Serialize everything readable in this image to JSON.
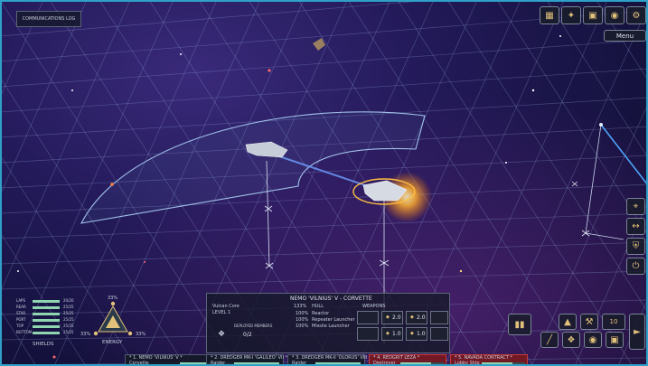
{
  "topleft": {
    "comms_label": "COMMUNICATIONS LOG"
  },
  "topright": {
    "menu_label": "Menu",
    "icons": [
      "map-icon",
      "ship-icon",
      "screen-icon",
      "target-icon",
      "gear-icon"
    ]
  },
  "rightside": {
    "icons": [
      "crosshair-icon",
      "expand-icon",
      "shield-icon",
      "power-icon"
    ]
  },
  "left_stats": {
    "energy_pct": "33%",
    "left_pct": "33%",
    "right_pct": "33%",
    "shields_label": "SHIELDS",
    "energy_label": "ENERGY",
    "rows": [
      {
        "name": "LAPS",
        "value": "20/20",
        "fill": 1.0
      },
      {
        "name": "REAR",
        "value": "25/25",
        "fill": 1.0
      },
      {
        "name": "STAR",
        "value": "25/25",
        "fill": 1.0
      },
      {
        "name": "PORT",
        "value": "25/25",
        "fill": 1.0
      },
      {
        "name": "TOP",
        "value": "25/25",
        "fill": 1.0
      },
      {
        "name": "BOTTOM",
        "value": "25/25",
        "fill": 1.0
      }
    ]
  },
  "ship_panel": {
    "title": "NEMO 'VILNIUS' V - CORVETTE",
    "subtitle_left": "Vulcan Core",
    "level": "LEVEL 1",
    "hull_pct": "133%",
    "hull_label": "HULL",
    "weapons_label": "WEAPONS",
    "systems": [
      {
        "pct": "100%",
        "name": "Reactor"
      },
      {
        "pct": "100%",
        "name": "Repeater Launcher"
      },
      {
        "pct": "100%",
        "name": "Missile Launcher"
      }
    ],
    "crew_label": "DEPLOYED MEMBERS",
    "crew_value": "0/2",
    "weapon_slots": [
      "2.0",
      "2.0",
      "1.0",
      "1.0"
    ]
  },
  "action_panel": {
    "counter": "10"
  },
  "fleet_tabs": [
    {
      "title": "* 1. NEMO 'VILNIUS' V *",
      "sub": "Corvette"
    },
    {
      "title": "* 2. DREDGER MK-I 'GALILEO' VII *",
      "sub": "Raider"
    },
    {
      "title": "* 3. DREDGER MK-II 'OLORUS' VIII *",
      "sub": "Raider"
    },
    {
      "title": "* 4. REDGRIT LEZA *",
      "sub": "Destroyer"
    },
    {
      "title": "* 5. NAVADA CONTRACT *",
      "sub": "Lobby Ship"
    }
  ]
}
